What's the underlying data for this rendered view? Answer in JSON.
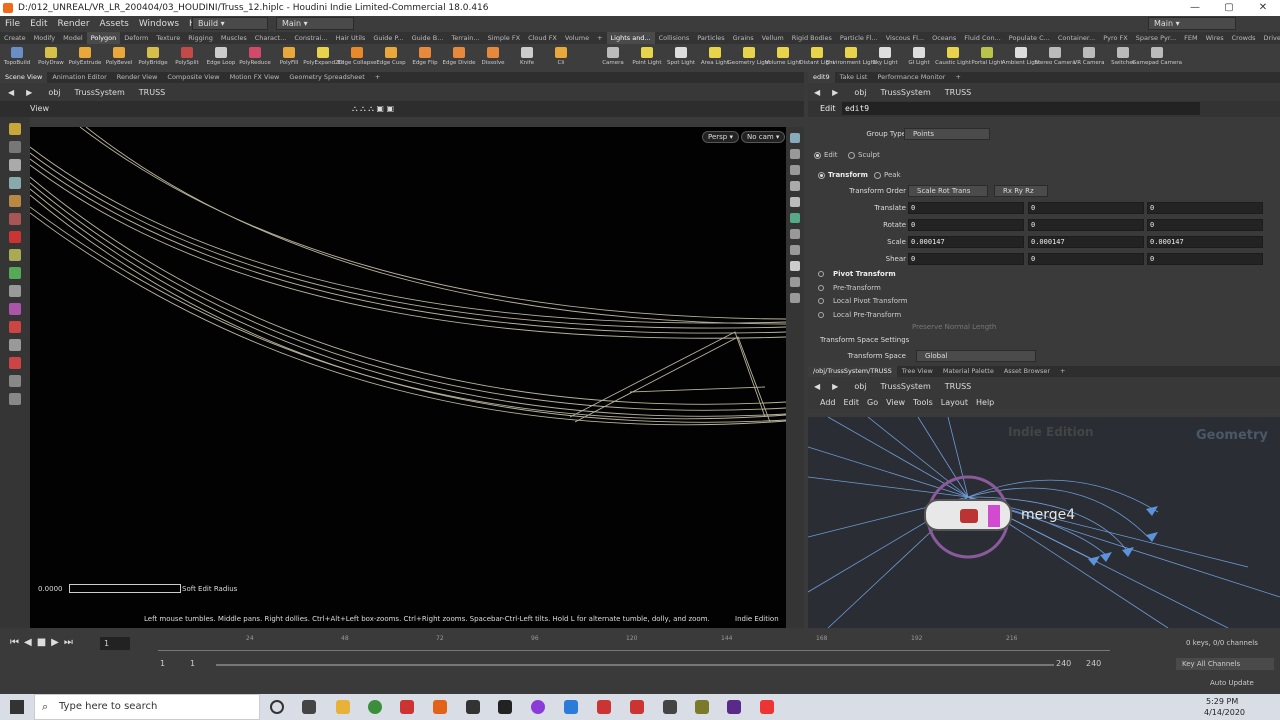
{
  "window": {
    "title": "D:/012_UNREAL/VR_LR_200404/03_HOUDINI/Truss_12.hiplc - Houdini Indie Limited-Commercial 18.0.416",
    "controls": [
      "—",
      "▢",
      "✕"
    ]
  },
  "menubar": {
    "items": [
      "File",
      "Edit",
      "Render",
      "Assets",
      "Windows",
      "Help"
    ],
    "desktop": "Build",
    "shelf_set": "Main",
    "right_desktop": "Main"
  },
  "shelf_tabs_left": [
    "Create",
    "Modify",
    "Model",
    "Polygon",
    "Deform",
    "Texture",
    "Rigging",
    "Muscles",
    "Charact...",
    "Constrai...",
    "Hair Utils",
    "Guide P...",
    "Guide B...",
    "Terrain...",
    "Simple FX",
    "Cloud FX",
    "Volume"
  ],
  "shelf_tabs_right": [
    "Lights and...",
    "Collisions",
    "Particles",
    "Grains",
    "Vellum",
    "Rigid Bodies",
    "Particle Fl...",
    "Viscous Fl...",
    "Oceans",
    "Fluid Con...",
    "Populate C...",
    "Container...",
    "Pyro FX",
    "Sparse Pyr...",
    "FEM",
    "Wires",
    "Crowds",
    "Drive Sim..."
  ],
  "tools_left": [
    {
      "label": "TopoBuild",
      "color": "#6a8fc7"
    },
    {
      "label": "PolyDraw",
      "color": "#d7c04a"
    },
    {
      "label": "PolyExtrude",
      "color": "#e8a83a"
    },
    {
      "label": "PolyBevel",
      "color": "#e8a83a"
    },
    {
      "label": "PolyBridge",
      "color": "#d7c04a"
    },
    {
      "label": "PolySplit",
      "color": "#c44a4a"
    },
    {
      "label": "Edge Loop",
      "color": "#ccc"
    },
    {
      "label": "PolyReduce",
      "color": "#d24a6a"
    },
    {
      "label": "PolyFill",
      "color": "#e8a83a"
    },
    {
      "label": "PolyExpand2D",
      "color": "#e8d44a"
    },
    {
      "label": "Edge Collapse",
      "color": "#e88a2a"
    },
    {
      "label": "Edge Cusp",
      "color": "#e8a83a"
    },
    {
      "label": "Edge Flip",
      "color": "#e8883a"
    },
    {
      "label": "Edge Divide",
      "color": "#e8883a"
    },
    {
      "label": "Dissolve",
      "color": "#e8883a"
    },
    {
      "label": "Knife",
      "color": "#ccc"
    },
    {
      "label": "Cli",
      "color": "#e8a83a"
    }
  ],
  "tools_right": [
    {
      "label": "Camera",
      "color": "#bbb"
    },
    {
      "label": "Point Light",
      "color": "#e8d44a"
    },
    {
      "label": "Spot Light",
      "color": "#ddd"
    },
    {
      "label": "Area Light",
      "color": "#e8d44a"
    },
    {
      "label": "Geometry Light",
      "color": "#e8d44a"
    },
    {
      "label": "Volume Light",
      "color": "#e8d44a"
    },
    {
      "label": "Distant Light",
      "color": "#e8d44a"
    },
    {
      "label": "Environment Light",
      "color": "#e8d44a"
    },
    {
      "label": "Sky Light",
      "color": "#ddd"
    },
    {
      "label": "GI Light",
      "color": "#ddd"
    },
    {
      "label": "Caustic Light",
      "color": "#e8d44a"
    },
    {
      "label": "Portal Light",
      "color": "#b8c44a"
    },
    {
      "label": "Ambient Light",
      "color": "#ddd"
    },
    {
      "label": "Stereo Camera",
      "color": "#bbb"
    },
    {
      "label": "VR Camera",
      "color": "#bbb"
    },
    {
      "label": "Switcher",
      "color": "#bbb"
    },
    {
      "label": "Gamepad Camera",
      "color": "#bbb"
    }
  ],
  "left_pane": {
    "tabs": [
      "Scene View",
      "Animation Editor",
      "Render View",
      "Composite View",
      "Motion FX View",
      "Geometry Spreadsheet",
      "+"
    ],
    "path": [
      "obj",
      "TrussSystem",
      "TRUSS"
    ],
    "view_label": "View",
    "persp": "Persp ▾",
    "cam": "No cam ▾",
    "soft_value": "0.0000",
    "soft_label": "Soft Edit Radius",
    "hint": "Left mouse tumbles. Middle pans. Right dollies. Ctrl+Alt+Left box-zooms. Ctrl+Right zooms. Spacebar-Ctrl-Left tilts. Hold L for alternate tumble, dolly, and zoom.",
    "edition": "Indie Edition"
  },
  "param_pane": {
    "tabs": [
      "edit9",
      "Take List",
      "Performance Monitor",
      "+"
    ],
    "path": [
      "obj",
      "TrussSystem",
      "TRUSS"
    ],
    "node_type": "Edit",
    "node_name": "edit9",
    "group_type_label": "Group Type",
    "group_type": "Points",
    "mode_edit": "Edit",
    "mode_sculpt": "Sculpt",
    "transform": "Transform",
    "peak": "Peak",
    "transform_order_label": "Transform Order",
    "transform_order": "Scale Rot Trans",
    "rot_order": "Rx Ry Rz",
    "rows": [
      {
        "label": "Translate",
        "v": [
          "0",
          "0",
          "0"
        ]
      },
      {
        "label": "Rotate",
        "v": [
          "0",
          "0",
          "0"
        ]
      },
      {
        "label": "Scale",
        "v": [
          "0.000147",
          "0.000147",
          "0.000147"
        ]
      },
      {
        "label": "Shear",
        "v": [
          "0",
          "0",
          "0"
        ]
      }
    ],
    "sections": [
      "Pivot Transform",
      "Pre-Transform",
      "Local Pivot Transform",
      "Local Pre-Transform"
    ],
    "preserve": "Preserve Normal Length",
    "space_settings": "Transform Space Settings",
    "space_label": "Transform Space",
    "space": "Global"
  },
  "net_pane": {
    "tabs": [
      "/obj/TrussSystem/TRUSS",
      "Tree View",
      "Material Palette",
      "Asset Browser",
      "+"
    ],
    "path": [
      "obj",
      "TrussSystem",
      "TRUSS"
    ],
    "menu": [
      "Add",
      "Edit",
      "Go",
      "View",
      "Tools",
      "Layout",
      "Help"
    ],
    "watermark": "Indie Edition",
    "context": "Geometry",
    "node": "merge4"
  },
  "timeline": {
    "frame": "1",
    "ticks": [
      "24",
      "48",
      "72",
      "96",
      "120",
      "144",
      "168",
      "192",
      "216"
    ],
    "start": "1",
    "start2": "1",
    "end": "240",
    "end2": "240",
    "keys": "0 keys, 0/0 channels",
    "key_all": "Key All Channels",
    "auto_update": "Auto Update"
  },
  "taskbar": {
    "search": "Type here to search",
    "time": "5:29 PM",
    "date": "4/14/2020"
  }
}
